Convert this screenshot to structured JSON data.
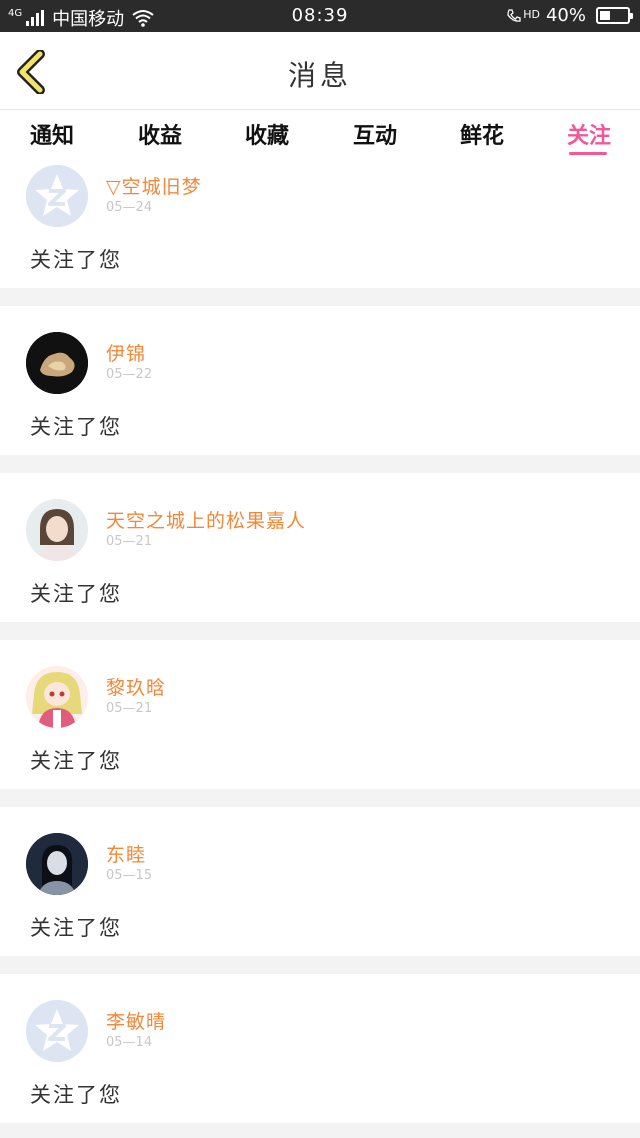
{
  "status_bar": {
    "network": "4G",
    "carrier": "中国移动",
    "time": "08:39",
    "hd": "HD",
    "battery": "40%",
    "battery_level": 0.4
  },
  "header": {
    "title": "消息",
    "back_icon": "chevron-left-icon"
  },
  "tabs": [
    {
      "label": "通知",
      "active": false
    },
    {
      "label": "收益",
      "active": false
    },
    {
      "label": "收藏",
      "active": false
    },
    {
      "label": "互动",
      "active": false
    },
    {
      "label": "鲜花",
      "active": false
    },
    {
      "label": "关注",
      "active": true
    }
  ],
  "colors": {
    "accent": "#f0589a",
    "name": "#f2883a",
    "date": "#c8c8c8"
  },
  "notifications": [
    {
      "name": "▽空城旧梦",
      "date": "05—24",
      "text": "关注了您",
      "avatar": "default-avatar"
    },
    {
      "name": "伊锦",
      "date": "05—22",
      "text": "关注了您",
      "avatar": "photo-dark"
    },
    {
      "name": "天空之城上的松果嘉人",
      "date": "05—21",
      "text": "关注了您",
      "avatar": "photo-girl"
    },
    {
      "name": "黎玖晗",
      "date": "05—21",
      "text": "关注了您",
      "avatar": "anime-girl"
    },
    {
      "name": "东睦",
      "date": "05—15",
      "text": "关注了您",
      "avatar": "photo-night"
    },
    {
      "name": "李敏晴",
      "date": "05—14",
      "text": "关注了您",
      "avatar": "default-avatar"
    }
  ]
}
